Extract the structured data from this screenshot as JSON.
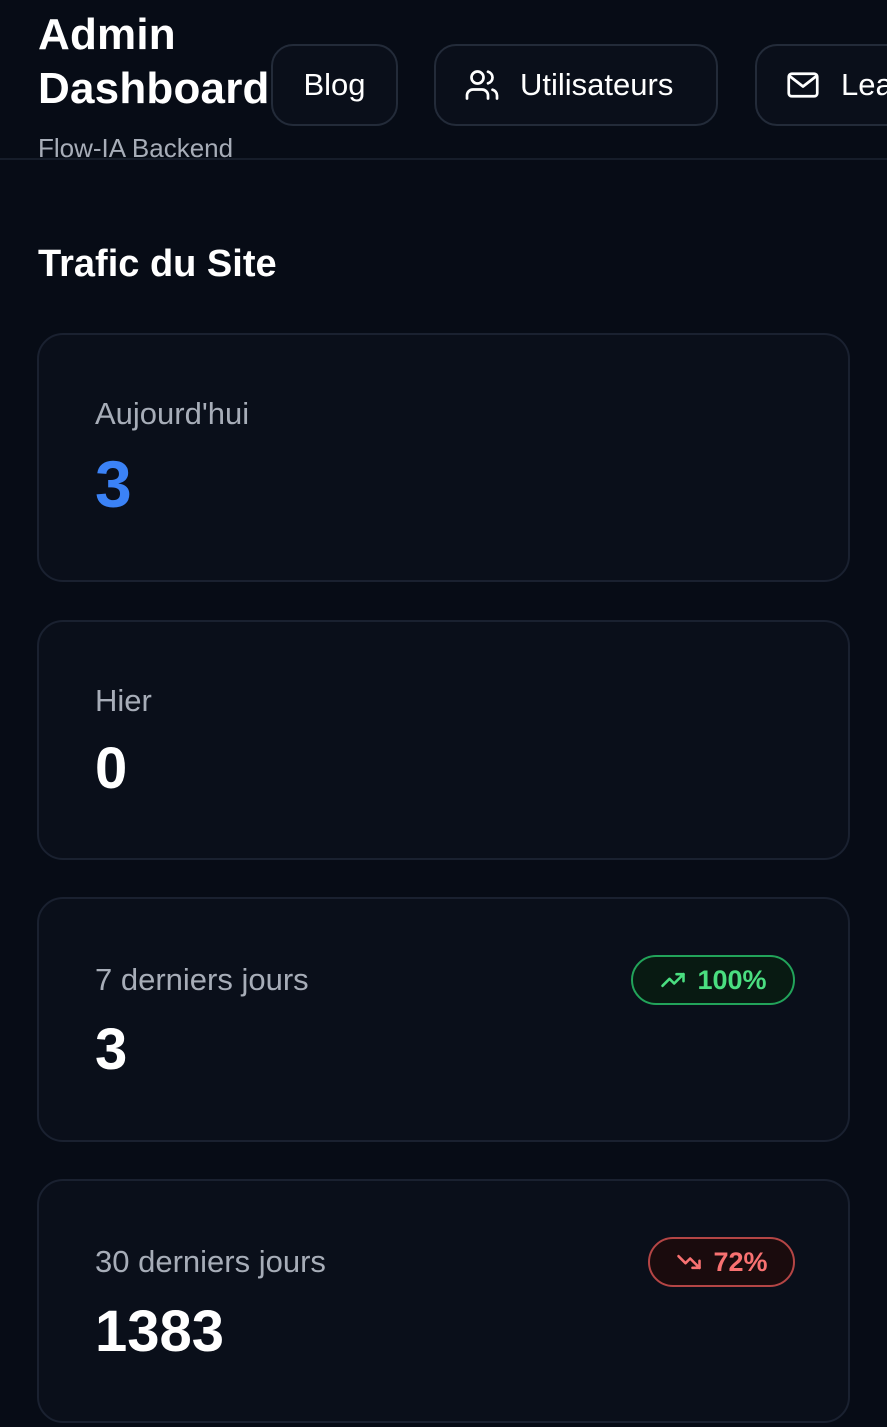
{
  "header": {
    "title_line1": "Admin",
    "title_line2": "Dashboard",
    "subtitle": "Flow-IA Backend"
  },
  "nav": {
    "blog": "Blog",
    "users": "Utilisateurs",
    "leads": "Leads"
  },
  "section": {
    "title": "Trafic du Site"
  },
  "stats": {
    "today": {
      "label": "Aujourd'hui",
      "value": "3"
    },
    "yesterday": {
      "label": "Hier",
      "value": "0"
    },
    "last7": {
      "label": "7 derniers jours",
      "value": "3",
      "trend": "100%",
      "trend_direction": "up"
    },
    "last30": {
      "label": "30 derniers jours",
      "value": "1383",
      "trend": "72%",
      "trend_direction": "down"
    }
  },
  "colors": {
    "accent": "#3b82f6",
    "trend_up": "#4ade80",
    "trend_down": "#f87171",
    "background": "#070c16"
  },
  "icons": {
    "users": "users-icon",
    "leads": "mail-icon",
    "trend_up": "trending-up-icon",
    "trend_down": "trending-down-icon"
  }
}
